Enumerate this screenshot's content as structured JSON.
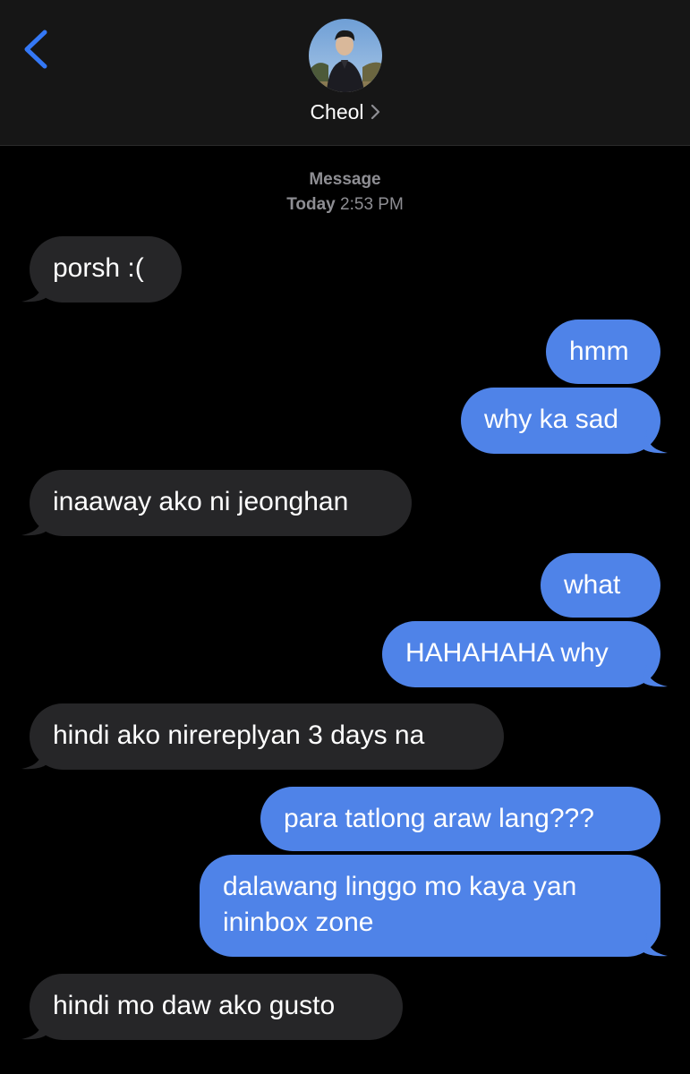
{
  "header": {
    "contact_name": "Cheol",
    "back_icon": "chevron-left-icon",
    "accent_color": "#3478f6"
  },
  "thread": {
    "service_label": "Message",
    "day_label": "Today",
    "time_label": "2:53 PM"
  },
  "colors": {
    "incoming_bubble": "#262628",
    "outgoing_bubble": "#4f83e8",
    "background": "#000000"
  },
  "messages": [
    {
      "direction": "incoming",
      "text": "porsh :("
    },
    {
      "direction": "outgoing",
      "text": "hmm"
    },
    {
      "direction": "outgoing",
      "text": "why ka sad"
    },
    {
      "direction": "incoming",
      "text": "inaaway ako ni jeonghan"
    },
    {
      "direction": "outgoing",
      "text": "what"
    },
    {
      "direction": "outgoing",
      "text": "HAHAHAHA why"
    },
    {
      "direction": "incoming",
      "text": "hindi ako nirereplyan 3 days na"
    },
    {
      "direction": "outgoing",
      "text": "para tatlong araw lang???"
    },
    {
      "direction": "outgoing",
      "text": "dalawang linggo mo kaya yan ininbox zone"
    },
    {
      "direction": "incoming",
      "text": "hindi mo daw ako gusto"
    }
  ]
}
